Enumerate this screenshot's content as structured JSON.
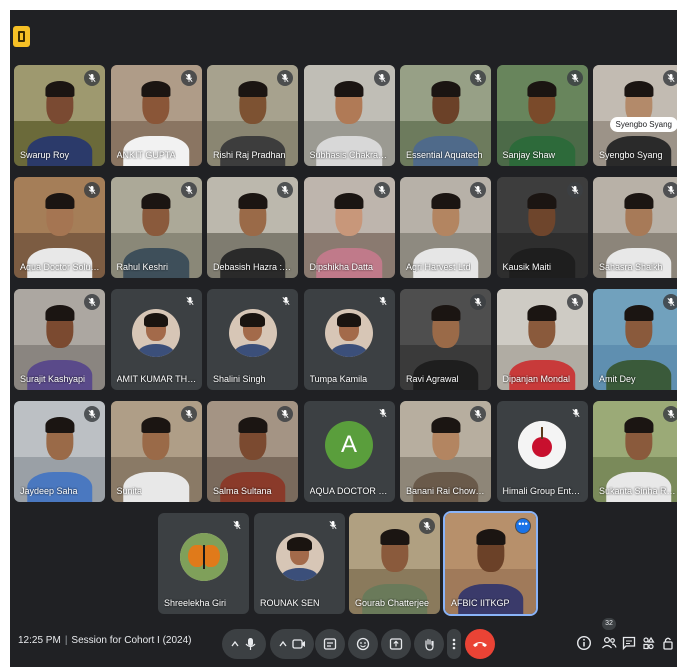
{
  "meeting": {
    "time": "12:25 PM",
    "title": "Session for Cohort I (2024)",
    "participant_count": "32"
  },
  "colors": {
    "background": "#202124",
    "tile": "#3c4043",
    "end_call": "#ea4335",
    "active_border": "#8ab4f8"
  },
  "participants": [
    {
      "name": "Swarup Roy"
    },
    {
      "name": "ANKIT GUPTA"
    },
    {
      "name": "Rishi Raj Pradhan"
    },
    {
      "name": "Subhasis Chakraborty"
    },
    {
      "name": "Essential Aquatech"
    },
    {
      "name": "Sanjay Shaw"
    },
    {
      "name": "Syengbo Syang"
    },
    {
      "name": "Aqua Doctor Solutions"
    },
    {
      "name": "Rahul Keshri"
    },
    {
      "name": "Debasish Hazra : Entrepr..."
    },
    {
      "name": "Dipshikha Datta"
    },
    {
      "name": "Agri Harvest Ltd"
    },
    {
      "name": "Kausik Maiti"
    },
    {
      "name": "Sahasra Shaikh"
    },
    {
      "name": "Surajit Kashyapi"
    },
    {
      "name": "AMIT KUMAR THAKUR"
    },
    {
      "name": "Shalini Singh"
    },
    {
      "name": "Tumpa Kamila"
    },
    {
      "name": "Ravi Agrawal"
    },
    {
      "name": "Dipanjan Mondal"
    },
    {
      "name": "Amit Dey"
    },
    {
      "name": "Jaydeep Saha"
    },
    {
      "name": "Sunita"
    },
    {
      "name": "Salma Sultana"
    },
    {
      "name": "AQUA DOCTOR SOLUTI..."
    },
    {
      "name": "Banani Rai Chowdhury"
    },
    {
      "name": "Himali Group Enterprise..."
    },
    {
      "name": "Sukanta Sinha Roy (SSR)"
    },
    {
      "name": "Shreelekha Giri"
    },
    {
      "name": "ROUNAK SEN"
    },
    {
      "name": "Gourab Chatterjee"
    },
    {
      "name": "AFBIC IITKGP"
    }
  ],
  "aqua_avatar_letter": "A",
  "icons": [
    "microphone-icon",
    "camera-icon",
    "captions-icon",
    "emoji-icon",
    "present-icon",
    "raise-hand-icon",
    "more-options-icon",
    "end-call-icon",
    "info-icon",
    "people-icon",
    "chat-icon",
    "activities-icon",
    "host-controls-icon"
  ]
}
